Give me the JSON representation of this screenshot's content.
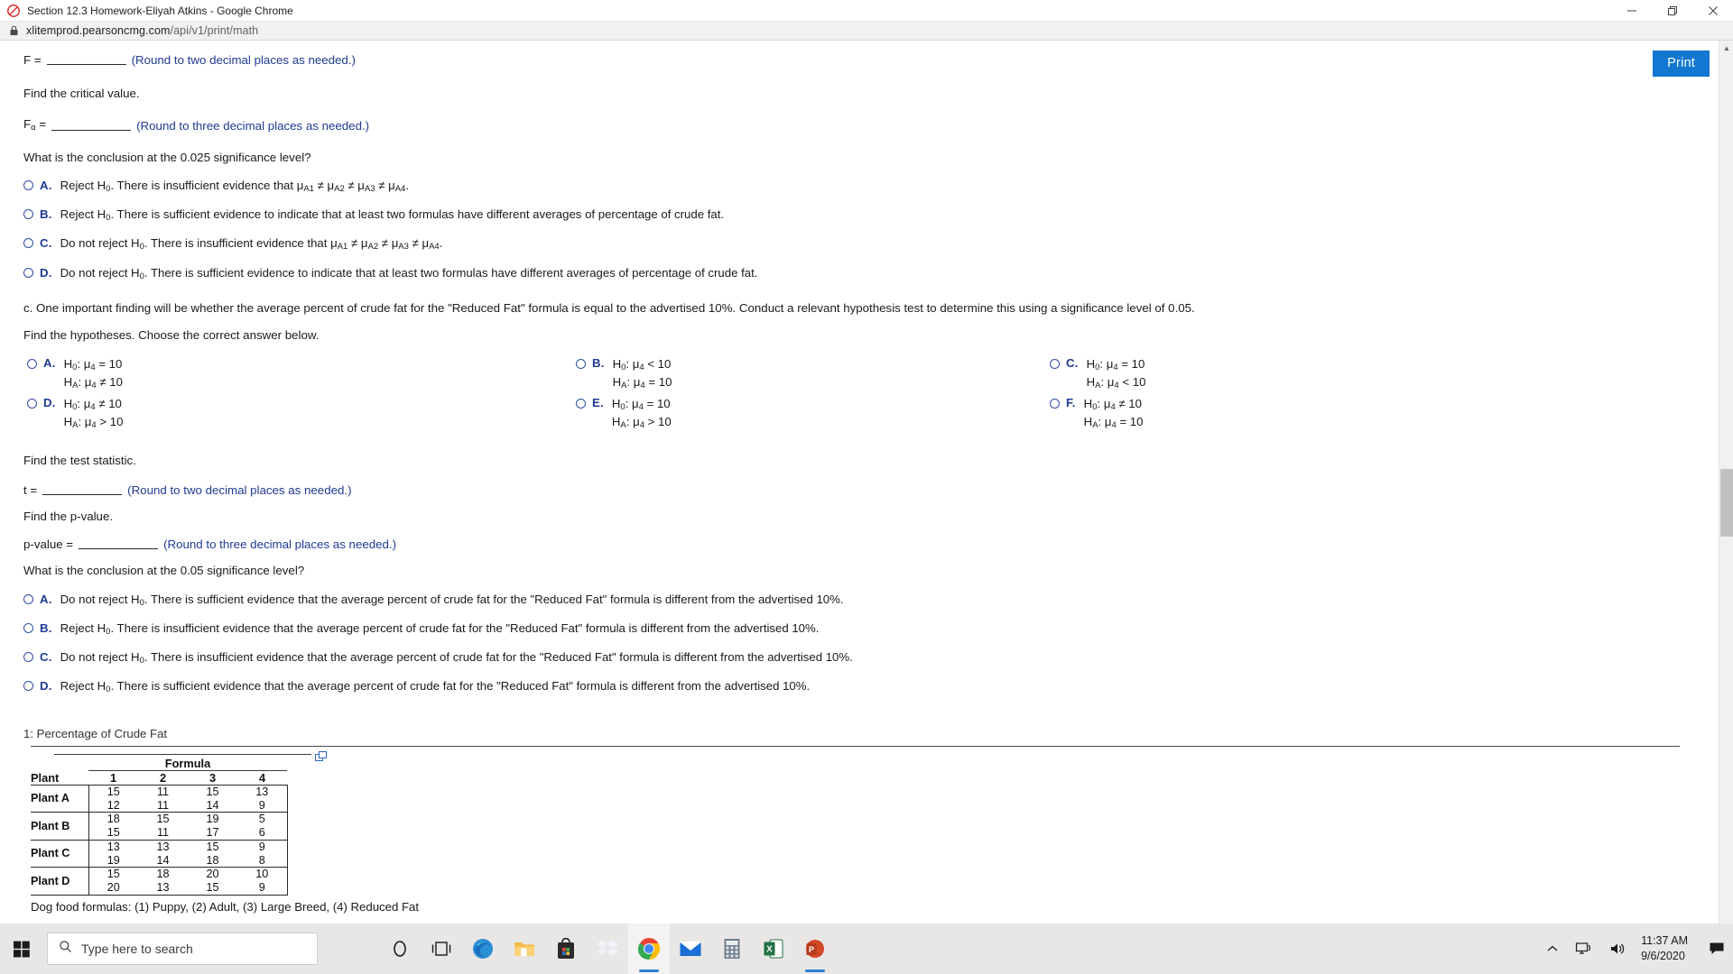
{
  "window": {
    "title": "Section 12.3 Homework-Eliyah Atkins - Google Chrome",
    "app_icon": "blocked-icon",
    "minimize_label": "Minimize",
    "restore_label": "Restore",
    "close_label": "Close"
  },
  "address_bar": {
    "lock_icon": "lock-icon",
    "url_scheme_host": "xlitemprod.pearsoncmg.com",
    "url_path": "/api/v1/print/math"
  },
  "toolbar": {
    "print_label": "Print"
  },
  "content": {
    "f_label": "F =",
    "f_hint": "(Round to two decimal places as needed.)",
    "find_critical": "Find the critical value.",
    "falpha_label_base": "F",
    "falpha_label_sub": "α",
    "falpha_eq": "=",
    "falpha_hint": "(Round to three decimal places as needed.)",
    "conclusion_q1": "What is the conclusion at the 0.025 significance level?",
    "options_b": [
      {
        "letter": "A.",
        "pre": "Reject H",
        "sub": "0",
        "text": ". There is insufficient evidence that μ",
        "mu": "A1 ≠ μA2 ≠ μA3 ≠ μA4.",
        "full": "Reject H0. There is insufficient evidence that μA1 ≠ μA2 ≠ μA3 ≠ μA4."
      },
      {
        "letter": "B.",
        "full": "Reject H0. There is sufficient evidence to indicate that at least two formulas have different averages of percentage of crude fat."
      },
      {
        "letter": "C.",
        "full": "Do not reject H0. There is insufficient evidence that μA1 ≠ μA2 ≠ μA3 ≠ μA4."
      },
      {
        "letter": "D.",
        "full": "Do not reject H0. There is sufficient evidence to indicate that at least two formulas have different averages of percentage of crude fat."
      }
    ],
    "part_c_paragraph": "c. One important finding will be whether the average percent of crude fat for the \"Reduced Fat\" formula is equal to the advertised 10%. Conduct a relevant hypothesis test to determine this using a significance level of 0.05.",
    "find_hypotheses": "Find the hypotheses. Choose the correct answer below.",
    "hypotheses": [
      {
        "letter": "A.",
        "h0": "H0: μ4 = 10",
        "ha": "HA: μ4 ≠ 10"
      },
      {
        "letter": "B.",
        "h0": "H0: μ4 < 10",
        "ha": "HA: μ4 = 10"
      },
      {
        "letter": "C.",
        "h0": "H0: μ4 = 10",
        "ha": "HA: μ4 < 10"
      },
      {
        "letter": "D.",
        "h0": "H0: μ4 ≠ 10",
        "ha": "HA: μ4 > 10"
      },
      {
        "letter": "E.",
        "h0": "H0: μ4 = 10",
        "ha": "HA: μ4 > 10"
      },
      {
        "letter": "F.",
        "h0": "H0: μ4 ≠ 10",
        "ha": "HA: μ4 = 10"
      }
    ],
    "find_test_statistic": "Find the test statistic.",
    "t_label": "t =",
    "t_hint": "(Round to two decimal places as needed.)",
    "find_pvalue": "Find the p-value.",
    "pvalue_label": "p-value =",
    "pvalue_hint": "(Round to three decimal places as needed.)",
    "conclusion_q2": "What is the conclusion at the 0.05 significance level?",
    "options_c": [
      {
        "letter": "A.",
        "full": "Do not reject H0. There is sufficient evidence that the average percent of crude fat for the \"Reduced Fat\" formula is different from the advertised 10%."
      },
      {
        "letter": "B.",
        "full": "Reject H0. There is insufficient evidence that the average percent of crude fat for the \"Reduced Fat\" formula is different from the advertised 10%."
      },
      {
        "letter": "C.",
        "full": "Do not reject H0. There is insufficient evidence that the average percent of crude fat for the \"Reduced Fat\" formula is different from the advertised 10%."
      },
      {
        "letter": "D.",
        "full": "Reject H0. There is sufficient evidence that the average percent of crude fat for the \"Reduced Fat\" formula is different from the advertised 10%."
      }
    ]
  },
  "chart_data": {
    "type": "table",
    "title": "1: Percentage of Crude Fat",
    "group_header": "Formula",
    "row_header": "Plant",
    "categories": [
      "1",
      "2",
      "3",
      "4"
    ],
    "rows": [
      {
        "label": "Plant A",
        "values": [
          [
            15,
            11,
            15,
            13
          ],
          [
            12,
            11,
            14,
            9
          ]
        ]
      },
      {
        "label": "Plant B",
        "values": [
          [
            18,
            15,
            19,
            5
          ],
          [
            15,
            11,
            17,
            6
          ]
        ]
      },
      {
        "label": "Plant C",
        "values": [
          [
            13,
            13,
            15,
            9
          ],
          [
            19,
            14,
            18,
            8
          ]
        ]
      },
      {
        "label": "Plant D",
        "values": [
          [
            15,
            18,
            20,
            10
          ],
          [
            20,
            13,
            15,
            9
          ]
        ]
      }
    ],
    "footnote": "Dog food formulas: (1) Puppy, (2) Adult, (3) Large Breed, (4) Reduced Fat",
    "copy_icon": "copy-icon"
  },
  "taskbar": {
    "start_icon": "windows-start-icon",
    "search_placeholder": "Type here to search",
    "search_icon": "search-icon",
    "items": [
      {
        "name": "cortana-icon",
        "label": "Cortana"
      },
      {
        "name": "task-view-icon",
        "label": "Task View"
      },
      {
        "name": "edge-icon",
        "label": "Microsoft Edge"
      },
      {
        "name": "file-explorer-icon",
        "label": "File Explorer"
      },
      {
        "name": "microsoft-store-icon",
        "label": "Microsoft Store"
      },
      {
        "name": "dropbox-icon",
        "label": "Dropbox"
      },
      {
        "name": "google-chrome-icon",
        "label": "Google Chrome"
      },
      {
        "name": "mail-icon",
        "label": "Mail"
      },
      {
        "name": "calculator-icon",
        "label": "Calculator"
      },
      {
        "name": "excel-icon",
        "label": "Excel"
      },
      {
        "name": "powerpoint-icon",
        "label": "PowerPoint"
      }
    ],
    "tray": {
      "chevron_icon": "show-hidden-icons-chevron",
      "network_icon": "network-icon",
      "volume_icon": "volume-icon",
      "time": "11:37 AM",
      "date": "9/6/2020",
      "action_center_icon": "action-center-icon"
    }
  }
}
